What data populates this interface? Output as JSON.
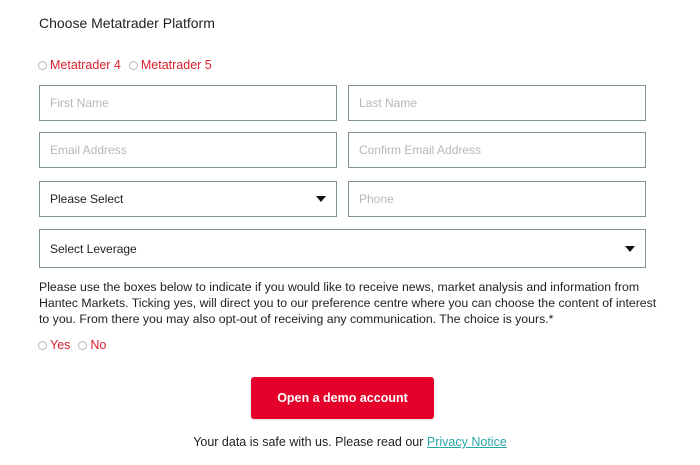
{
  "platform": {
    "title": "Choose Metatrader Platform",
    "options": [
      "Metatrader 4",
      "Metatrader 5"
    ]
  },
  "form": {
    "first_name_placeholder": "First Name",
    "last_name_placeholder": "Last Name",
    "email_placeholder": "Email Address",
    "confirm_email_placeholder": "Confirm Email Address",
    "country_select": "Please Select",
    "phone_placeholder": "Phone",
    "leverage_select": "Select Leverage"
  },
  "consent": {
    "text": "Please use the boxes below to indicate if you would like to receive news, market analysis and information from Hantec Markets. Ticking yes, will direct you to our preference centre where you can choose the content of interest to you. From there you may also opt-out of receiving any communication. The choice is yours.*",
    "options": [
      "Yes",
      "No"
    ]
  },
  "submit_label": "Open a demo account",
  "footer": {
    "text": "Your data is safe with us. Please read our ",
    "link": "Privacy Notice"
  },
  "colors": {
    "accent_red": "#e4002b",
    "link_teal": "#2aa6a6",
    "field_border": "#7c9296"
  }
}
